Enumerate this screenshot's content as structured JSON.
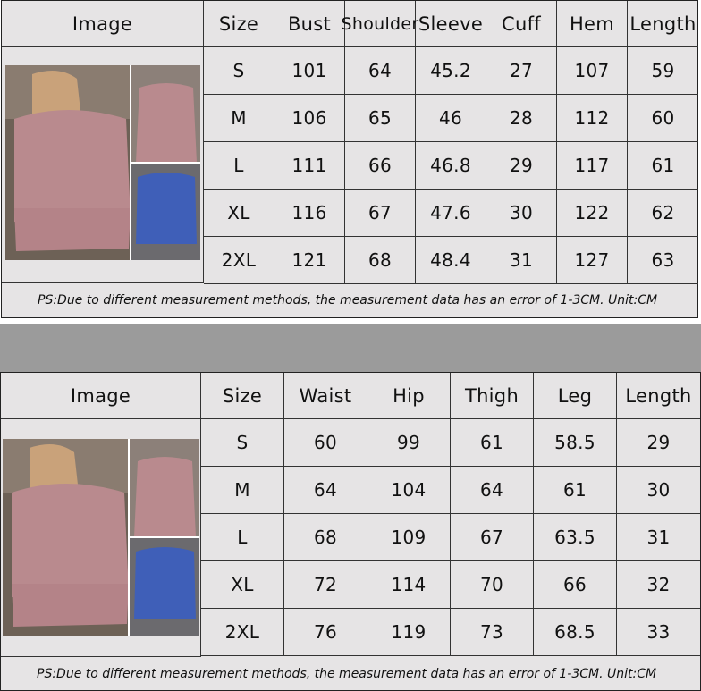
{
  "top_table": {
    "headers": [
      "Image",
      "Size",
      "Bust",
      "Shoulder",
      "Sleeve",
      "Cuff",
      "Hem",
      "Length"
    ],
    "rows": [
      [
        "S",
        "101",
        "64",
        "45.2",
        "27",
        "107",
        "59"
      ],
      [
        "M",
        "106",
        "65",
        "46",
        "28",
        "112",
        "60"
      ],
      [
        "L",
        "111",
        "66",
        "46.8",
        "29",
        "117",
        "61"
      ],
      [
        "XL",
        "116",
        "67",
        "47.6",
        "30",
        "122",
        "62"
      ],
      [
        "2XL",
        "121",
        "68",
        "48.4",
        "31",
        "127",
        "63"
      ]
    ],
    "note": "PS:Due to different measurement methods, the measurement data has an error of 1-3CM.    Unit:CM"
  },
  "bottom_table": {
    "headers": [
      "Image",
      "Size",
      "Waist",
      "Hip",
      "Thigh",
      "Leg",
      "Length"
    ],
    "rows": [
      [
        "S",
        "60",
        "99",
        "61",
        "58.5",
        "29"
      ],
      [
        "M",
        "64",
        "104",
        "64",
        "61",
        "30"
      ],
      [
        "L",
        "68",
        "109",
        "67",
        "63.5",
        "31"
      ],
      [
        "XL",
        "72",
        "114",
        "70",
        "66",
        "32"
      ],
      [
        "2XL",
        "76",
        "119",
        "73",
        "68.5",
        "33"
      ]
    ],
    "note": "PS:Due to different measurement methods, the measurement data has an error of 1-3CM.    Unit:CM"
  },
  "colors": {
    "table_bg": "#e6e4e5",
    "band": "#9b9b9b",
    "pink": "#b98a8e",
    "blue": "#3f5fb8"
  }
}
